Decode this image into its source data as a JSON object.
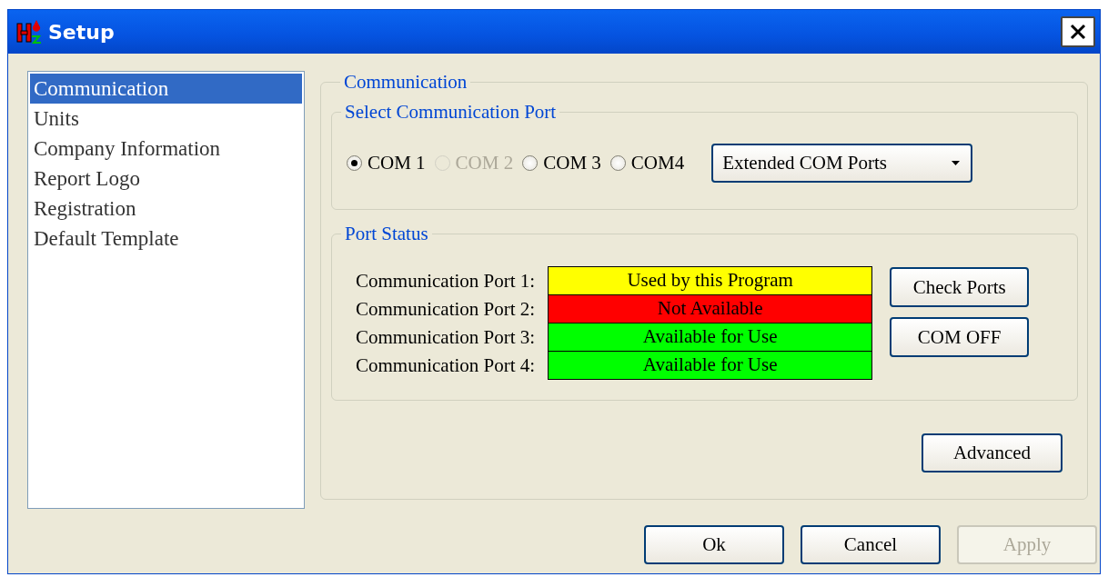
{
  "window": {
    "title": "Setup"
  },
  "sidebar": {
    "items": [
      {
        "label": "Communication",
        "selected": true
      },
      {
        "label": "Units",
        "selected": false
      },
      {
        "label": "Company Information",
        "selected": false
      },
      {
        "label": "Report Logo",
        "selected": false
      },
      {
        "label": "Registration",
        "selected": false
      },
      {
        "label": "Default Template",
        "selected": false
      }
    ]
  },
  "communication": {
    "title": "Communication",
    "port_select": {
      "title": "Select Communication Port",
      "radios": [
        {
          "label": "COM 1",
          "selected": true,
          "disabled": false
        },
        {
          "label": "COM 2",
          "selected": false,
          "disabled": true
        },
        {
          "label": "COM 3",
          "selected": false,
          "disabled": false
        },
        {
          "label": "COM4",
          "selected": false,
          "disabled": false
        }
      ],
      "dropdown": {
        "value": "Extended COM Ports"
      }
    },
    "port_status": {
      "title": "Port Status",
      "rows": [
        {
          "label": "Communication Port 1:",
          "status": "Used by this Program",
          "color": "#ffff00"
        },
        {
          "label": "Communication Port 2:",
          "status": "Not Available",
          "color": "#ff0000"
        },
        {
          "label": "Communication Port 3:",
          "status": "Available for Use",
          "color": "#00ff00"
        },
        {
          "label": "Communication Port 4:",
          "status": "Available for Use",
          "color": "#00ff00"
        }
      ],
      "buttons": [
        {
          "label": "Check Ports"
        },
        {
          "label": "COM OFF"
        }
      ]
    },
    "advanced_button": {
      "label": "Advanced"
    }
  },
  "buttons": [
    {
      "label": "Ok",
      "disabled": false
    },
    {
      "label": "Cancel",
      "disabled": false
    },
    {
      "label": "Apply",
      "disabled": true
    }
  ]
}
